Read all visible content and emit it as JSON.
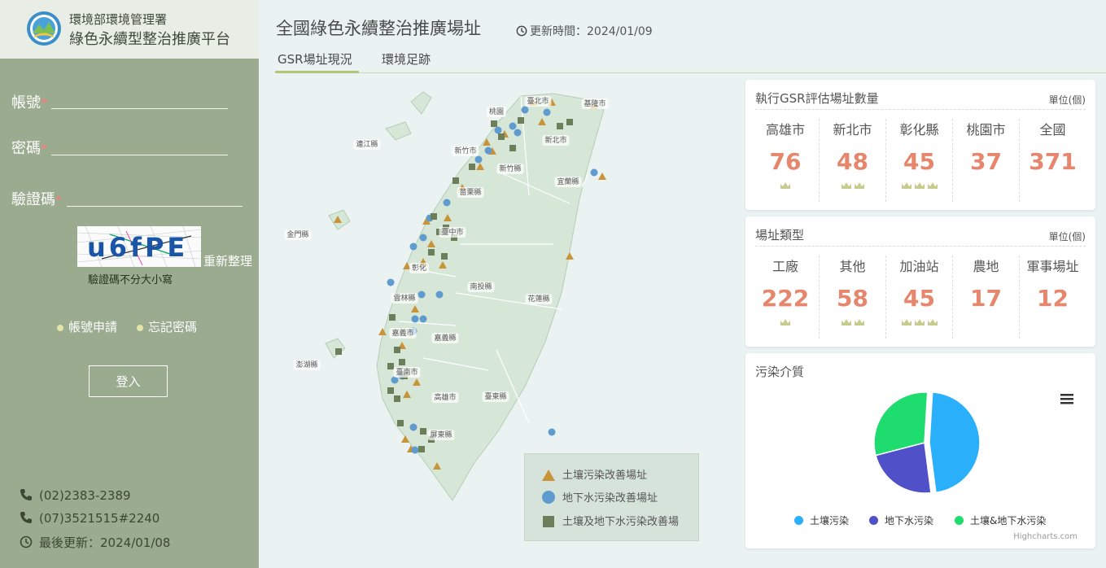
{
  "brand": {
    "agency": "環境部環境管理署",
    "platform": "綠色永續型整治推廣平台"
  },
  "login": {
    "account_label": "帳號",
    "password_label": "密碼",
    "captcha_label": "驗證碼",
    "required_mark": "*",
    "captcha_text": "u6fPE",
    "refresh_label": "重新整理",
    "captcha_hint": "驗證碼不分大小寫",
    "apply_link": "帳號申請",
    "forgot_link": "忘記密碼",
    "login_button": "登入"
  },
  "contact": {
    "phone1": "(02)2383-2389",
    "phone2": "(07)3521515#2240",
    "last_update_label": "最後更新：",
    "last_update": "2024/01/08"
  },
  "header": {
    "title": "全國綠色永續整治推廣場址",
    "update_label": "更新時間：",
    "update_date": "2024/01/09",
    "tabs": [
      "GSR場址現況",
      "環境足跡"
    ],
    "active_tab": 0
  },
  "map": {
    "county_labels": [
      "臺北市",
      "基隆市",
      "新北市",
      "新竹市",
      "新竹縣",
      "宜蘭縣",
      "苗栗縣",
      "臺中市",
      "彰化",
      "南投縣",
      "花蓮縣",
      "雲林縣",
      "嘉義市",
      "嘉義縣",
      "臺南市",
      "高雄市",
      "臺東縣",
      "屏東縣",
      "桃園",
      "連江縣",
      "金門縣",
      "澎湖縣"
    ],
    "legend": [
      {
        "label": "土壤污染改善場址",
        "icon": "triangle-icon",
        "color": "#c9933a"
      },
      {
        "label": "地下水污染改善場址",
        "icon": "circle-icon",
        "color": "#5f9bcf"
      },
      {
        "label": "土壤及地下水污染改善場",
        "icon": "square-icon",
        "color": "#6d7f5a"
      }
    ]
  },
  "gsr_count": {
    "title": "執行GSR評估場址數量",
    "unit": "單位(個)",
    "items": [
      {
        "label": "高雄市",
        "value": "76",
        "crowns": 1
      },
      {
        "label": "新北市",
        "value": "48",
        "crowns": 2
      },
      {
        "label": "彰化縣",
        "value": "45",
        "crowns": 3
      },
      {
        "label": "桃園市",
        "value": "37",
        "crowns": 0
      },
      {
        "label": "全國",
        "value": "371",
        "crowns": 0
      }
    ]
  },
  "site_type": {
    "title": "場址類型",
    "unit": "單位(個)",
    "items": [
      {
        "label": "工廠",
        "value": "222",
        "crowns": 1
      },
      {
        "label": "其他",
        "value": "58",
        "crowns": 2
      },
      {
        "label": "加油站",
        "value": "45",
        "crowns": 3
      },
      {
        "label": "農地",
        "value": "17",
        "crowns": 0
      },
      {
        "label": "軍事場址",
        "value": "12",
        "crowns": 0
      }
    ]
  },
  "pollution_medium": {
    "title": "污染介質",
    "credit": "Highcharts.com",
    "chart_data": {
      "type": "pie",
      "categories": [
        "土壤污染",
        "地下水污染",
        "土壤&地下水污染"
      ],
      "values": [
        47,
        23,
        30
      ],
      "colors": [
        "#2ab0fa",
        "#5050c8",
        "#1edc6e"
      ],
      "legend_placement": "bottom"
    }
  },
  "colors": {
    "sidebar": "#9aab8f",
    "accent_value": "#e5866d",
    "crown": "#c6cc8e",
    "tab_underline": "#b6c47a"
  }
}
